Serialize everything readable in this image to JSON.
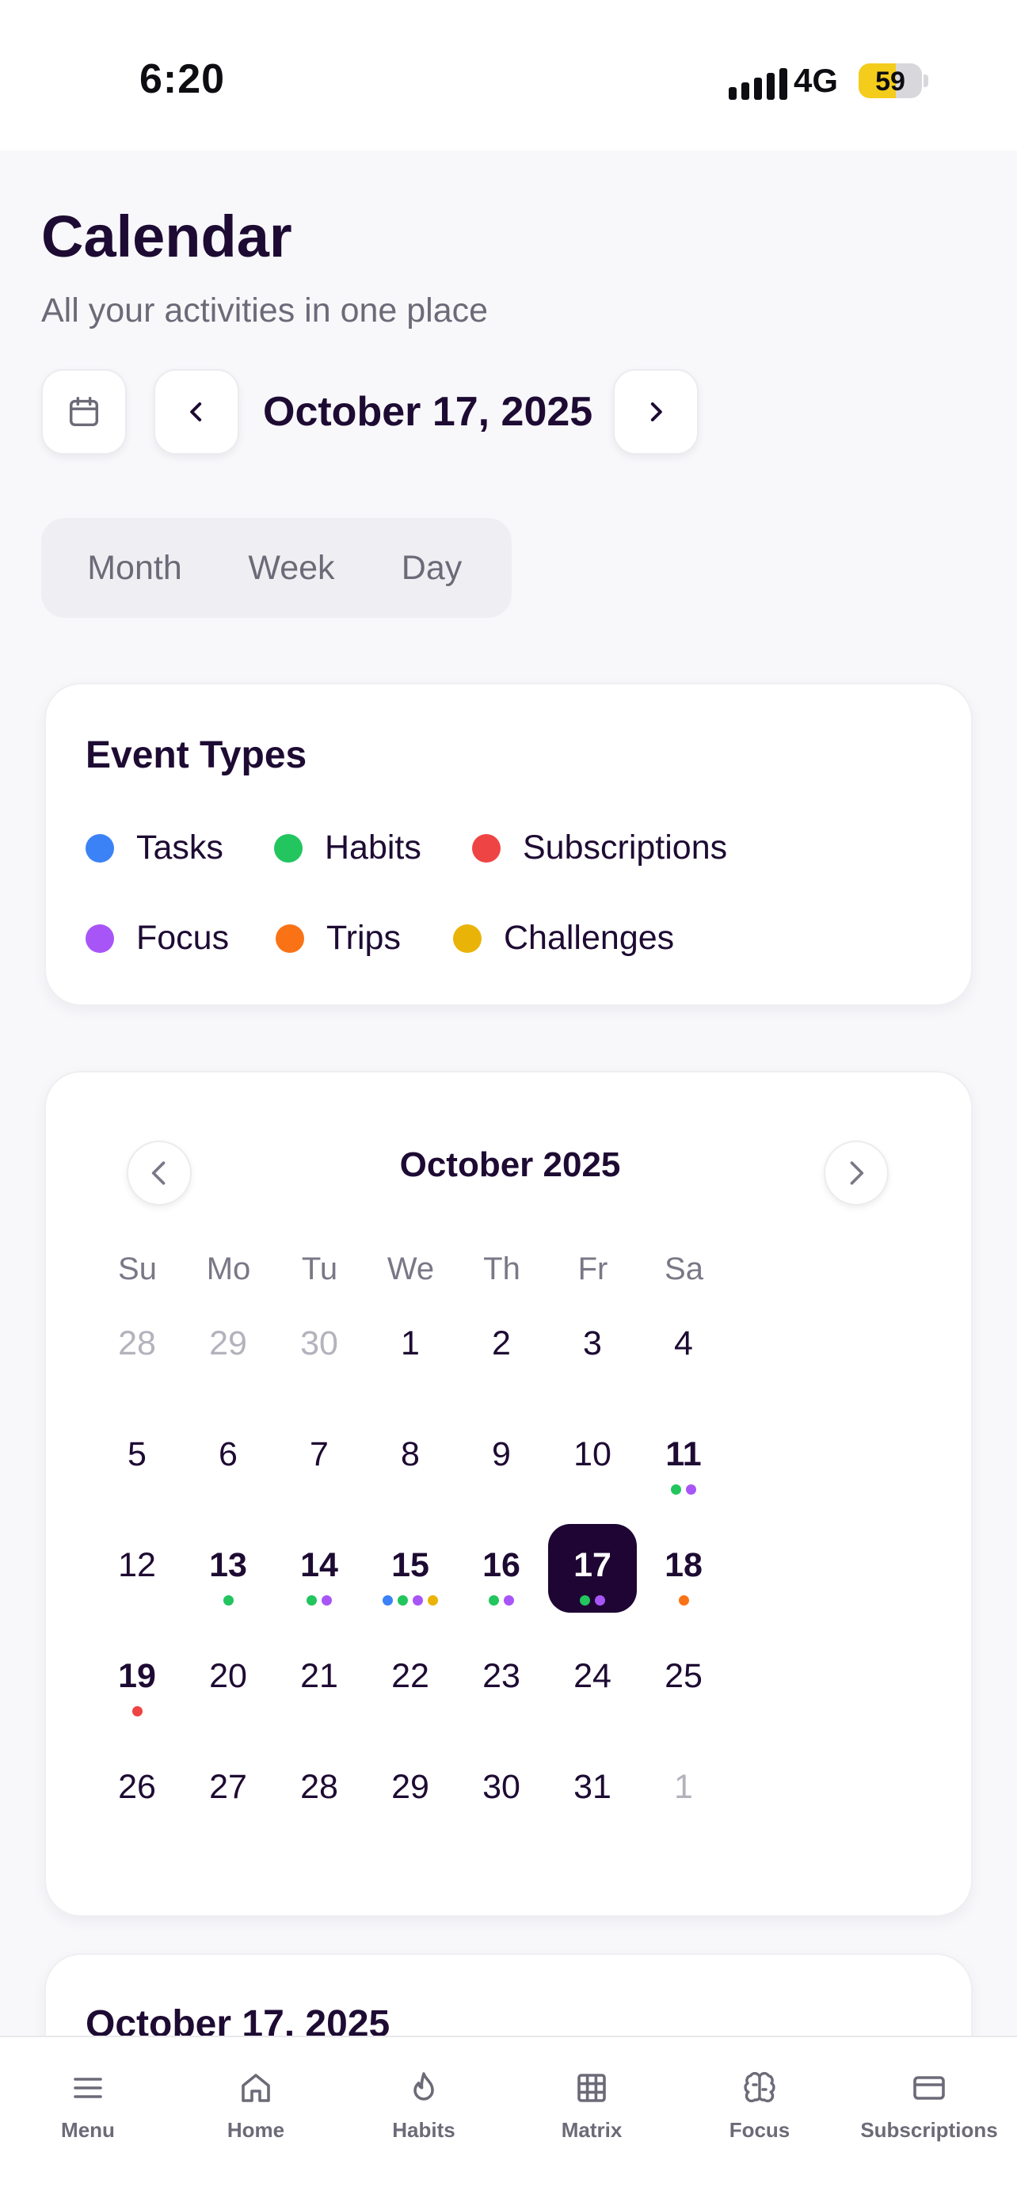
{
  "status": {
    "time": "6:20",
    "network": "4G",
    "battery": "59",
    "battery_level": 0.59
  },
  "header": {
    "title": "Calendar",
    "subtitle": "All your activities in one place"
  },
  "date_nav": {
    "current_date": "October 17, 2025"
  },
  "view_tabs": [
    {
      "label": "Month",
      "active": true
    },
    {
      "label": "Week",
      "active": false
    },
    {
      "label": "Day",
      "active": false
    }
  ],
  "event_types": {
    "title": "Event Types",
    "items": [
      {
        "label": "Tasks",
        "color": "#3b82f6"
      },
      {
        "label": "Habits",
        "color": "#22c55e"
      },
      {
        "label": "Subscriptions",
        "color": "#ef4444"
      },
      {
        "label": "Focus",
        "color": "#a855f7"
      },
      {
        "label": "Trips",
        "color": "#f97316"
      },
      {
        "label": "Challenges",
        "color": "#eab308"
      }
    ]
  },
  "calendar": {
    "month_title": "October 2025",
    "weekdays": [
      "Su",
      "Mo",
      "Tu",
      "We",
      "Th",
      "Fr",
      "Sa"
    ],
    "weeks": [
      [
        {
          "d": "28",
          "out": true
        },
        {
          "d": "29",
          "out": true
        },
        {
          "d": "30",
          "out": true
        },
        {
          "d": "1"
        },
        {
          "d": "2"
        },
        {
          "d": "3"
        },
        {
          "d": "4"
        }
      ],
      [
        {
          "d": "5"
        },
        {
          "d": "6"
        },
        {
          "d": "7"
        },
        {
          "d": "8"
        },
        {
          "d": "9"
        },
        {
          "d": "10"
        },
        {
          "d": "11",
          "dots": [
            "Habits",
            "Focus"
          ]
        }
      ],
      [
        {
          "d": "12"
        },
        {
          "d": "13",
          "dots": [
            "Habits"
          ]
        },
        {
          "d": "14",
          "dots": [
            "Habits",
            "Focus"
          ]
        },
        {
          "d": "15",
          "dots": [
            "Tasks",
            "Habits",
            "Focus",
            "Challenges"
          ]
        },
        {
          "d": "16",
          "dots": [
            "Habits",
            "Focus"
          ]
        },
        {
          "d": "17",
          "dots": [
            "Habits",
            "Focus"
          ],
          "selected": true
        },
        {
          "d": "18",
          "dots": [
            "Trips"
          ]
        }
      ],
      [
        {
          "d": "19",
          "dots": [
            "Subscriptions"
          ]
        },
        {
          "d": "20"
        },
        {
          "d": "21"
        },
        {
          "d": "22"
        },
        {
          "d": "23"
        },
        {
          "d": "24"
        },
        {
          "d": "25"
        }
      ],
      [
        {
          "d": "26"
        },
        {
          "d": "27"
        },
        {
          "d": "28"
        },
        {
          "d": "29"
        },
        {
          "d": "30"
        },
        {
          "d": "31"
        },
        {
          "d": "1",
          "out": true
        }
      ]
    ]
  },
  "day_detail": {
    "title": "October 17, 2025"
  },
  "bottom_nav": [
    {
      "label": "Menu",
      "icon": "menu-icon"
    },
    {
      "label": "Home",
      "icon": "home-icon"
    },
    {
      "label": "Habits",
      "icon": "flame-icon"
    },
    {
      "label": "Matrix",
      "icon": "grid-icon"
    },
    {
      "label": "Focus",
      "icon": "brain-icon"
    },
    {
      "label": "Subscriptions",
      "icon": "credit-card-icon"
    }
  ]
}
